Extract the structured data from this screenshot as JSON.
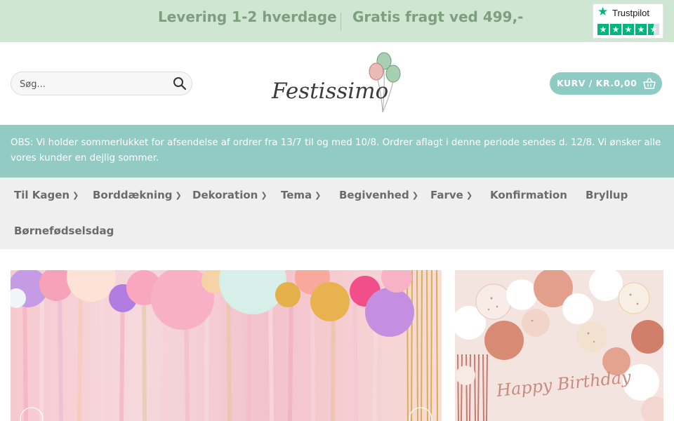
{
  "topbar": {
    "message_delivery": "Levering 1-2 hverdage",
    "message_shipping": "Gratis fragt ved 499,-",
    "trustpilot_label": "Trustpilot",
    "trustpilot_star_icon": "star-icon",
    "brand_color": "#00b67a"
  },
  "header": {
    "search": {
      "placeholder": "Søg...",
      "value": "",
      "icon": "search-icon"
    },
    "logo_text": "Festissimo",
    "cart": {
      "label": "KURV / KR.0,00",
      "icon": "basket-icon",
      "color": "#8ecbc4"
    }
  },
  "notice": {
    "text": "OBS: Vi holder sommerlukket for afsendelse af ordrer fra 13/7 til og med 10/8. Ordrer aflagt i denne periode sendes d. 12/8. Vi ønsker alle vores kunder en dejlig sommer.",
    "background": "#91cbc4"
  },
  "nav": {
    "items": [
      {
        "label": "Til Kagen",
        "dropdown": true
      },
      {
        "label": "Borddækning",
        "dropdown": true
      },
      {
        "label": "Dekoration",
        "dropdown": true
      },
      {
        "label": "Tema",
        "dropdown": true
      },
      {
        "label": "Begivenhed",
        "dropdown": true
      },
      {
        "label": "Farve",
        "dropdown": true
      },
      {
        "label": "Konfirmation",
        "dropdown": false
      },
      {
        "label": "Bryllup",
        "dropdown": false
      },
      {
        "label": "Børnefødselsdag",
        "dropdown": false
      }
    ],
    "chevron_icon": "chevron-down-icon"
  },
  "banners": {
    "left_image": "balloon-garland-photo",
    "right_image": "happy-birthday-balloons-photo",
    "right_banner_script_text": "Happy Birthday"
  }
}
